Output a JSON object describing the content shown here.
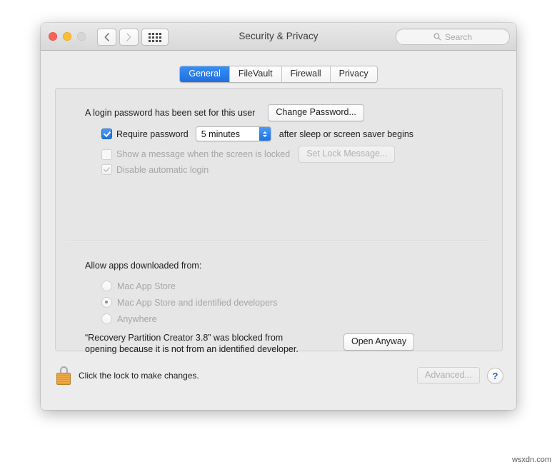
{
  "window": {
    "title": "Security & Privacy",
    "traffic_lights": [
      "close",
      "minimize",
      "zoom"
    ],
    "nav": {
      "back": "back-arrow",
      "forward": "forward-arrow",
      "showall": "show-all-grid"
    },
    "search": {
      "placeholder": "Search",
      "icon": "search-icon",
      "value": ""
    }
  },
  "tabs": [
    {
      "label": "General",
      "active": true
    },
    {
      "label": "FileVault",
      "active": false
    },
    {
      "label": "Firewall",
      "active": false
    },
    {
      "label": "Privacy",
      "active": false
    }
  ],
  "general": {
    "login_password_text": "A login password has been set for this user",
    "change_password_button": "Change Password...",
    "require_password": {
      "label": "Require password",
      "checked": true,
      "interval": "5 minutes",
      "suffix": "after sleep or screen saver begins"
    },
    "show_message": {
      "label": "Show a message when the screen is locked",
      "checked": false,
      "button": "Set Lock Message...",
      "disabled": true
    },
    "disable_auto_login": {
      "label": "Disable automatic login",
      "checked": true,
      "disabled": true
    }
  },
  "gatekeeper": {
    "heading": "Allow apps downloaded from:",
    "options": [
      {
        "label": "Mac App Store",
        "selected": false
      },
      {
        "label": "Mac App Store and identified developers",
        "selected": true
      },
      {
        "label": "Anywhere",
        "selected": false
      }
    ],
    "blocked_message_line1": "“Recovery Partition Creator 3.8” was blocked from",
    "blocked_message_line2": "opening because it is not from an identified developer.",
    "open_anyway_button": "Open Anyway"
  },
  "footer": {
    "lock_icon": "padlock-locked-icon",
    "lock_text": "Click the lock to make changes.",
    "advanced_button": "Advanced...",
    "advanced_disabled": true,
    "help_button": "?"
  },
  "watermark": "wsxdn.com",
  "colors": {
    "accent_blue": "#1f72e3",
    "tab_active_bg": "#2f82ec",
    "window_bg": "#ececec",
    "panel_bg": "#e6e6e6",
    "lock_orange": "#f0a846"
  }
}
